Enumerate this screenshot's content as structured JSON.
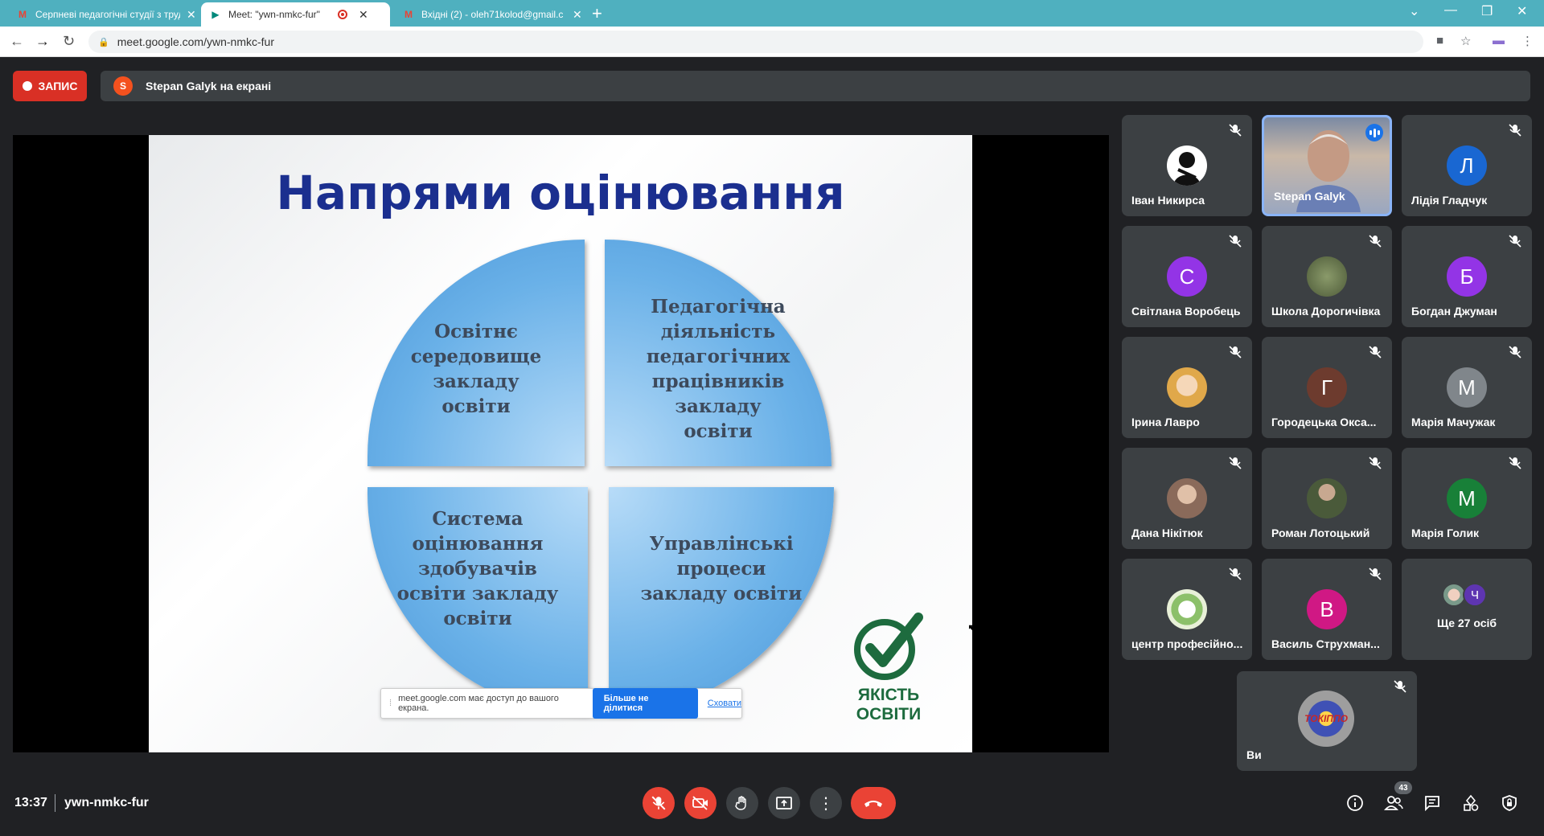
{
  "browser": {
    "tabs": [
      {
        "title": "Серпневі педагогічні студії з труд",
        "favicon": "gmail-icon"
      },
      {
        "title": "Meet: \"ywn-nmkc-fur\"",
        "favicon": "meet-icon"
      },
      {
        "title": "Вхідні (2) - oleh71kolod@gmail.c",
        "favicon": "gmail-icon"
      }
    ],
    "url": "meet.google.com/ywn-nmkc-fur"
  },
  "meet": {
    "record_label": "ЗАПИС",
    "presenter_initial": "S",
    "presenting_text": "Stepan Galyk на екрані",
    "time": "13:37",
    "meeting_code": "ywn-nmkc-fur",
    "participants_count": "43"
  },
  "slide": {
    "title": "Напрями оцінювання",
    "q1": "Освітнє середовище закладу освіти",
    "q2": "Педагогічна діяльність педагогічних працівників закладу освіти",
    "q3": "Система оцінювання здобувачів освіти закладу освіти",
    "q4": "Управлінські процеси закладу освіти",
    "logo_line1": "ЯКІСТЬ",
    "logo_line2": "ОСВІТИ"
  },
  "share_notice": {
    "text": "meet.google.com має доступ до вашого екрана.",
    "stop_label": "Більше не ділитися",
    "hide_label": "Сховати"
  },
  "participants": [
    {
      "name": "Іван Никирса",
      "initial": "",
      "color": "#ffffff"
    },
    {
      "name": "Stepan Galyk",
      "initial": "",
      "color": ""
    },
    {
      "name": "Лідія Гладчук",
      "initial": "Л",
      "color": "#1967d2"
    },
    {
      "name": "Світлана Воробець",
      "initial": "С",
      "color": "#9334e6"
    },
    {
      "name": "Школа Дорогичівка",
      "initial": "",
      "color": "#6b7b4a"
    },
    {
      "name": "Богдан Джуман",
      "initial": "Б",
      "color": "#9334e6"
    },
    {
      "name": "Ірина Лавро",
      "initial": "",
      "color": "#e9b96e"
    },
    {
      "name": "Городецька Окса...",
      "initial": "Г",
      "color": "#6d3b2e"
    },
    {
      "name": "Марія Мачужак",
      "initial": "М",
      "color": "#80868b"
    },
    {
      "name": "Дана Нікітюк",
      "initial": "",
      "color": "#a08070"
    },
    {
      "name": "Роман Лотоцький",
      "initial": "",
      "color": "#5a6a48"
    },
    {
      "name": "Марія Голик",
      "initial": "М",
      "color": "#188038"
    },
    {
      "name": "центр професійно...",
      "initial": "",
      "color": "#e8f0d8"
    },
    {
      "name": "Василь Струхман...",
      "initial": "В",
      "color": "#d01884"
    },
    {
      "name": "Ще 27 осіб",
      "initial": "Ч",
      "color": "#5e35b1"
    },
    {
      "name": "Ви",
      "initial": "",
      "color": "#4a5a8a"
    }
  ]
}
